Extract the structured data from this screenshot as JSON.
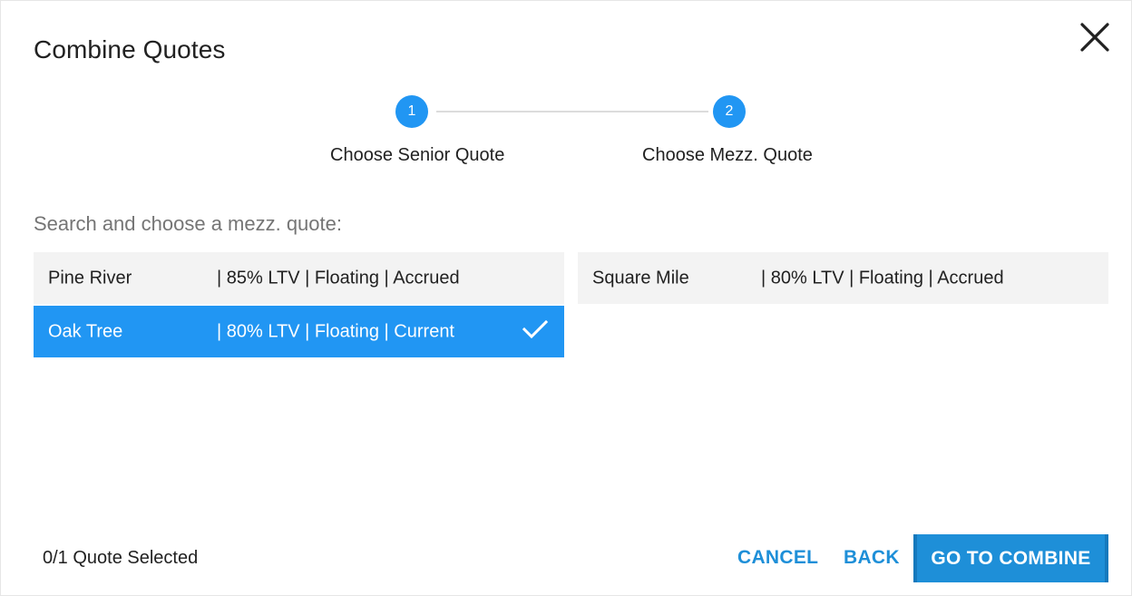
{
  "dialog": {
    "title": "Combine Quotes",
    "close_icon": "close-icon"
  },
  "stepper": {
    "steps": [
      {
        "number": "1",
        "label": "Choose Senior Quote"
      },
      {
        "number": "2",
        "label": "Choose Mezz. Quote"
      }
    ],
    "accent_color": "#2196f3"
  },
  "search": {
    "prompt": "Search and choose a mezz. quote:"
  },
  "quotes": [
    {
      "name": "Pine River",
      "details": "| 85% LTV | Floating | Accrued",
      "selected": false
    },
    {
      "name": "Oak Tree",
      "details": "| 80% LTV | Floating | Current",
      "selected": true,
      "icon": "checkmark-icon"
    },
    {
      "name": "Square Mile",
      "details": "| 80% LTV | Floating | Accrued",
      "selected": false
    }
  ],
  "footer": {
    "selected_count": "0/1 Quote Selected",
    "cancel_label": "CANCEL",
    "back_label": "BACK",
    "go_label": "GO TO COMBINE",
    "button_color": "#1e8fd8"
  }
}
